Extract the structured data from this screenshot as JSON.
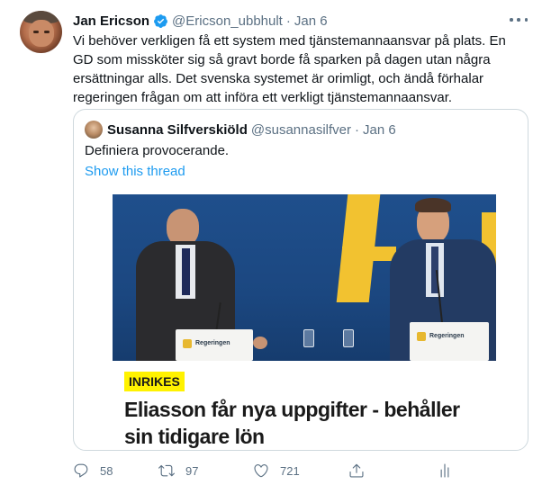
{
  "tweet": {
    "display_name": "Jan Ericson",
    "handle": "@Ericson_ubbhult",
    "separator": "·",
    "date": "Jan 6",
    "text": "Vi behöver verkligen få ett system med tjänstemannaansvar på plats. En GD som missköter sig så gravt borde få sparken på dagen utan några ersättningar alls. Det svenska systemet är orimligt, och ändå förhalar regeringen frågan om att införa ett verkligt tjänstemannaansvar."
  },
  "quoted_tweet": {
    "display_name": "Susanna Silfverskiöld",
    "handle": "@susannasilfver",
    "separator": "·",
    "date": "Jan 6",
    "text": "Definiera provocerande.",
    "show_thread": "Show this thread",
    "article": {
      "tag": "INRIKES",
      "headline": "Eliasson får nya uppgifter - behåller sin tidigare lön",
      "podium_label_left": "Regeringen",
      "podium_label_right": "Regeringen"
    }
  },
  "actions": {
    "replies": "58",
    "retweets": "97",
    "likes": "721"
  },
  "colors": {
    "text_primary": "#0f1419",
    "text_secondary": "#5b7083",
    "link": "#1d9bf0",
    "verified": "#1d9bf0",
    "border": "#cfd9de",
    "tag_bg": "#fff200"
  },
  "icons": [
    "verified-badge-icon",
    "more-options-icon",
    "reply-icon",
    "retweet-icon",
    "like-icon",
    "share-icon",
    "analytics-icon"
  ]
}
